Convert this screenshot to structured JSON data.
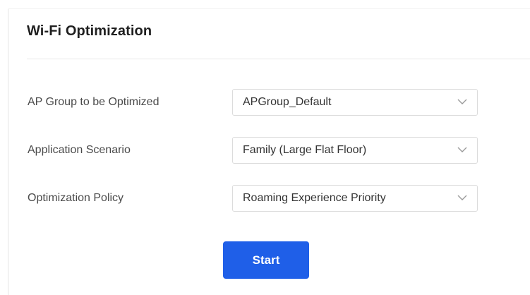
{
  "page": {
    "title": "Wi-Fi Optimization"
  },
  "form": {
    "fields": [
      {
        "label": "AP Group to be Optimized",
        "value": "APGroup_Default",
        "icon": "chevron-down-icon"
      },
      {
        "label": "Application Scenario",
        "value": "Family (Large Flat Floor)",
        "icon": "chevron-down-icon"
      },
      {
        "label": "Optimization Policy",
        "value": "Roaming Experience Priority",
        "icon": "chevron-down-icon"
      }
    ],
    "start_label": "Start"
  },
  "colors": {
    "primary": "#1f5fe8",
    "title": "#1f1f1f",
    "label": "#4a4a4a",
    "border": "#dcdcdc"
  }
}
